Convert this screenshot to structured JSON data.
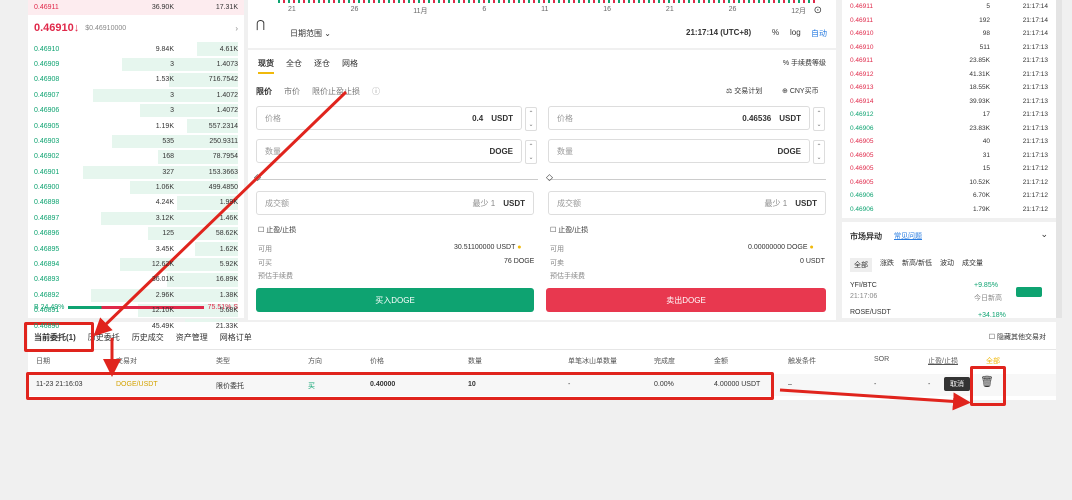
{
  "orderbook_left": {
    "top_row": {
      "price": "0.46911",
      "amount": "36.90K",
      "total": "17.31K"
    },
    "last_price": "0.46910↓",
    "last_price_sub": "$0.46910000",
    "rows": [
      [
        "0.46910",
        "9.84K",
        "4.61K"
      ],
      [
        "0.46909",
        "3",
        "1.4073"
      ],
      [
        "0.46908",
        "1.53K",
        "716.7542"
      ],
      [
        "0.46907",
        "3",
        "1.4072"
      ],
      [
        "0.46906",
        "3",
        "1.4072"
      ],
      [
        "0.46905",
        "1.19K",
        "557.2314"
      ],
      [
        "0.46903",
        "535",
        "250.9311"
      ],
      [
        "0.46902",
        "168",
        "78.7954"
      ],
      [
        "0.46901",
        "327",
        "153.3663"
      ],
      [
        "0.46900",
        "1.06K",
        "499.4850"
      ],
      [
        "0.46898",
        "4.24K",
        "1.99K"
      ],
      [
        "0.46897",
        "3.12K",
        "1.46K"
      ],
      [
        "0.46896",
        "125",
        "58.62K"
      ],
      [
        "0.46895",
        "3.45K",
        "1.62K"
      ],
      [
        "0.46894",
        "12.62K",
        "5.92K"
      ],
      [
        "0.46893",
        "36.01K",
        "16.89K"
      ],
      [
        "0.46892",
        "2.96K",
        "1.38K"
      ],
      [
        "0.46891",
        "12.10K",
        "5.68K"
      ],
      [
        "0.46890",
        "45.49K",
        "21.33K"
      ]
    ],
    "ratio_buy": "B 24.49%",
    "ratio_sell": "75.51% S"
  },
  "chart": {
    "dates": [
      "21",
      "26",
      "11月",
      "6",
      "11",
      "16",
      "21",
      "26",
      "12月"
    ],
    "range_label": "日期范围",
    "time": "21:17:14 (UTC+8)",
    "log": "log",
    "auto": "自动"
  },
  "trade": {
    "tabs": [
      "现货",
      "全仓",
      "逐仓",
      "网格"
    ],
    "fee_level": "手续费等级",
    "order_types": [
      "限价",
      "市价",
      "限价止盈止损"
    ],
    "calculator": "交易计划",
    "currency": "CNY买币",
    "buy": {
      "price_label": "价格",
      "price": "0.4",
      "unit": "USDT",
      "qty_label": "数量",
      "qty_unit": "DOGE",
      "total_label": "成交额",
      "total_min": "最少 1",
      "total_unit": "USDT",
      "tpsl": "止盈/止损",
      "avail_label": "可用",
      "avail": "30.51100000 USDT",
      "can_buy_label": "可买",
      "can_buy": "76 DOGE",
      "fee": "预估手续费",
      "button": "买入DOGE"
    },
    "sell": {
      "price_label": "价格",
      "price": "0.46536",
      "unit": "USDT",
      "qty_label": "数量",
      "qty_unit": "DOGE",
      "total_label": "成交额",
      "total_min": "最少 1",
      "total_unit": "USDT",
      "tpsl": "止盈/止损",
      "avail_label": "可用",
      "avail": "0.00000000 DOGE",
      "can_sell_label": "可卖",
      "can_sell": "0 USDT",
      "fee": "预估手续费",
      "button": "卖出DOGE"
    }
  },
  "trades_right": {
    "rows": [
      [
        "0.46911",
        "5",
        "21:17:14"
      ],
      [
        "0.46911",
        "192",
        "21:17:14"
      ],
      [
        "0.46910",
        "98",
        "21:17:14"
      ],
      [
        "0.46910",
        "511",
        "21:17:13"
      ],
      [
        "0.46911",
        "23.85K",
        "21:17:13"
      ],
      [
        "0.46912",
        "41.31K",
        "21:17:13"
      ],
      [
        "0.46913",
        "18.55K",
        "21:17:13"
      ],
      [
        "0.46914",
        "39.93K",
        "21:17:13"
      ],
      [
        "0.46912",
        "17",
        "21:17:13"
      ],
      [
        "0.46906",
        "23.83K",
        "21:17:13"
      ],
      [
        "0.46905",
        "40",
        "21:17:13"
      ],
      [
        "0.46905",
        "31",
        "21:17:13"
      ],
      [
        "0.46905",
        "15",
        "21:17:12"
      ],
      [
        "0.46905",
        "10.52K",
        "21:17:12"
      ],
      [
        "0.46906",
        "6.70K",
        "21:17:12"
      ],
      [
        "0.46906",
        "1.79K",
        "21:17:12"
      ]
    ],
    "colors": [
      "red",
      "red",
      "red",
      "red",
      "red",
      "red",
      "red",
      "red",
      "green",
      "green",
      "red",
      "red",
      "red",
      "red",
      "green",
      "green"
    ]
  },
  "market_moves": {
    "title": "市场异动",
    "link": "常见问题",
    "tabs": [
      "全部",
      "涨跌",
      "新高/新低",
      "波动",
      "成交量"
    ],
    "items": [
      {
        "pair": "YFI/BTC",
        "time": "21:17:06",
        "change": "+9.85%",
        "note": "今日新高"
      },
      {
        "pair": "ROSE/USDT",
        "time": "",
        "change": "+34.18%",
        "note": ""
      }
    ]
  },
  "orders": {
    "tabs": [
      "当前委托(1)",
      "历史委托",
      "历史成交",
      "资产管理",
      "网格订单"
    ],
    "hide_others": "隐藏其他交易对",
    "headers": [
      "日期",
      "交易对",
      "类型",
      "方向",
      "价格",
      "数量",
      "单笔冰山单数量",
      "完成度",
      "金额",
      "触发条件",
      "SOR",
      "止盈/止损",
      "全部"
    ],
    "row": {
      "date": "11-23 21:16:03",
      "pair": "DOGE/USDT",
      "type": "限价委托",
      "side": "买",
      "price": "0.40000",
      "amount": "10",
      "iceberg": "-",
      "filled": "0.00%",
      "total": "4.00000 USDT",
      "trigger": "–",
      "sor": "-",
      "tpsl": "-",
      "cancel": "取消"
    }
  },
  "colors": {
    "buy": "#0ea371",
    "sell": "#e0294a",
    "annotation": "#e0241d"
  }
}
